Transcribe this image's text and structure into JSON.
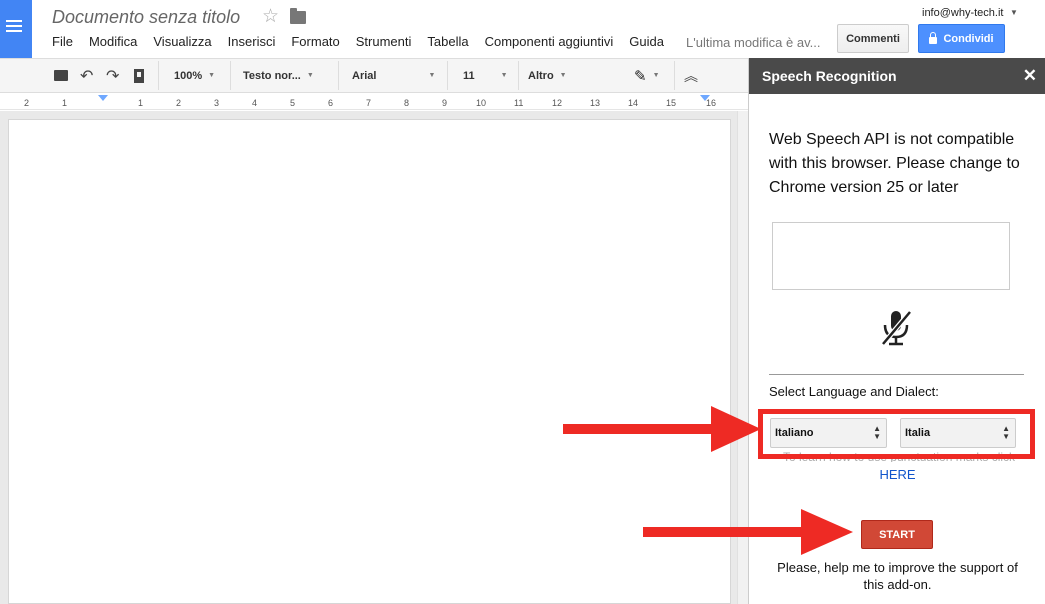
{
  "header": {
    "doc_title": "Documento senza titolo",
    "account": "info@why-tech.it",
    "comments_label": "Commenti",
    "share_label": "Condividi",
    "last_edit": "L'ultima modifica è av..."
  },
  "menu": [
    "File",
    "Modifica",
    "Visualizza",
    "Inserisci",
    "Formato",
    "Strumenti",
    "Tabella",
    "Componenti aggiuntivi",
    "Guida"
  ],
  "toolbar": {
    "zoom": "100%",
    "style": "Testo nor...",
    "font": "Arial",
    "size": "11",
    "more": "Altro"
  },
  "ruler": {
    "ticks": [
      "2",
      "1",
      "1",
      "2",
      "3",
      "4",
      "5",
      "6",
      "7",
      "8",
      "9",
      "10",
      "11",
      "12",
      "13",
      "14",
      "15",
      "16"
    ]
  },
  "panel": {
    "title": "Speech Recognition",
    "compat_message": "Web Speech API is not compatible with this browser. Please change to Chrome version 25 or later",
    "lang_label": "Select Language and Dialect:",
    "language": "Italiano",
    "dialect": "Italia",
    "punctuation_text": "To learn how to use punctuation marks click",
    "here_link": "HERE",
    "start_label": "START",
    "support_text": "Please, help me to improve the support of this add-on."
  },
  "icons": {
    "app": "docs-menu-icon",
    "star": "star-icon",
    "folder": "folder-icon",
    "mic": "mic-off-icon",
    "close": "close-icon"
  },
  "colors": {
    "app_blue": "#4285f4",
    "share_blue": "#4d90fe",
    "start_red": "#d14836",
    "annotation_red": "#ee2a24",
    "panel_header": "#4a4a4a",
    "link_blue": "#1155cc"
  }
}
